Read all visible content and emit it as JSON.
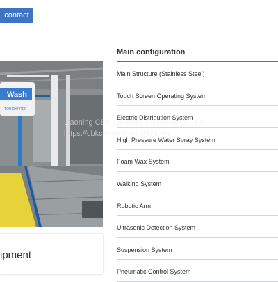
{
  "contact": {
    "label": "contact"
  },
  "photo": {
    "sign_text": "Wash",
    "sign_subtext": "TOUCH FREE"
  },
  "caption": {
    "text": "ipment"
  },
  "config": {
    "title": "Main configuration",
    "items": [
      {
        "label": "Main Structure (Stainless Steel)"
      },
      {
        "label": "Touch Screen Operating System"
      },
      {
        "label": "Electric Distribution System"
      },
      {
        "label": "High Pressure Water Spray System"
      },
      {
        "label": "Foam Wax System"
      },
      {
        "label": "Walking System"
      },
      {
        "label": "Robotic Arm"
      },
      {
        "label": "Ultrasonic Detection System"
      },
      {
        "label": "Suspension System"
      },
      {
        "label": "Pneumatic Control System"
      }
    ]
  },
  "watermark": {
    "line1": "Liaoning CBK Carwash Solutions Co., Ltd",
    "line2": "https://cbkcarwash.en.china.cn/"
  },
  "colors": {
    "accent": "#3f74c2",
    "floor_yellow": "#e8d23a",
    "row_divider": "#cfd5dd"
  }
}
